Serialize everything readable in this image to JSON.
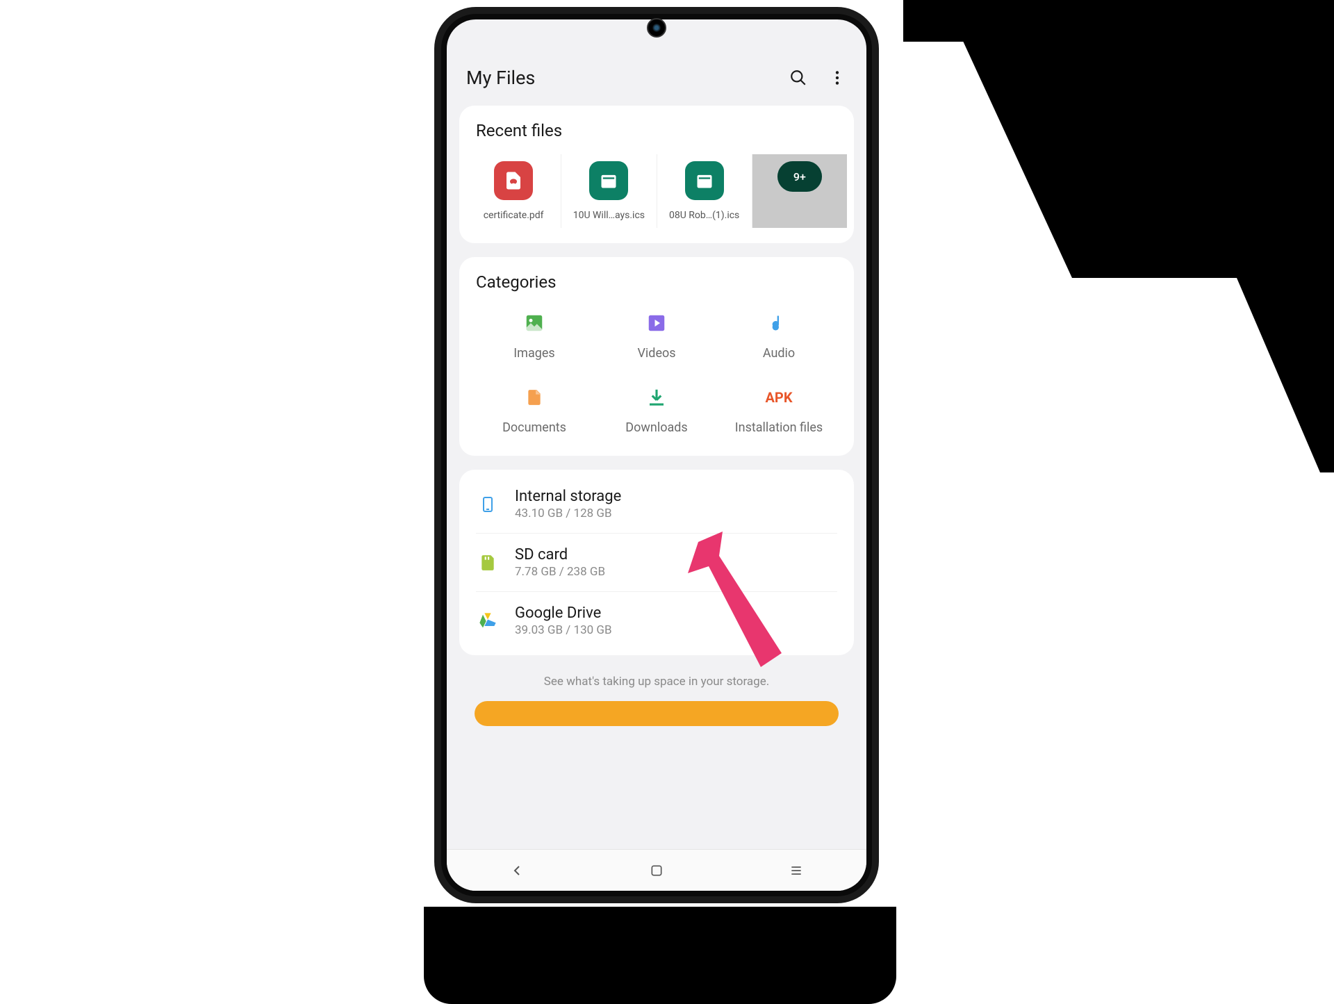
{
  "header": {
    "title": "My Files"
  },
  "recent": {
    "title": "Recent files",
    "items": [
      {
        "name": "certificate.pdf",
        "type": "pdf"
      },
      {
        "name": "10U Will…ays.ics",
        "type": "ics"
      },
      {
        "name": "08U Rob…(1).ics",
        "type": "ics"
      },
      {
        "name": "",
        "type": "more",
        "badge": "9+"
      }
    ]
  },
  "categories": {
    "title": "Categories",
    "items": [
      {
        "label": "Images",
        "icon": "image",
        "color": "#4fb04f"
      },
      {
        "label": "Videos",
        "icon": "video",
        "color": "#8a6be8"
      },
      {
        "label": "Audio",
        "icon": "audio",
        "color": "#3fa0e8"
      },
      {
        "label": "Documents",
        "icon": "document",
        "color": "#f5a04f"
      },
      {
        "label": "Downloads",
        "icon": "download",
        "color": "#1fa570"
      },
      {
        "label": "Installation files",
        "icon": "apk",
        "color": "#e8562a"
      }
    ]
  },
  "storage": [
    {
      "name": "Internal storage",
      "size": "43.10 GB / 128 GB",
      "icon": "phone",
      "color": "#3fa0e8"
    },
    {
      "name": "SD card",
      "size": "7.78 GB / 238 GB",
      "icon": "sd",
      "color": "#a5c93f"
    },
    {
      "name": "Google Drive",
      "size": "39.03 GB / 130 GB",
      "icon": "drive",
      "color": "#4fb04f"
    }
  ],
  "footer": {
    "text": "See what's taking up space in your storage."
  }
}
